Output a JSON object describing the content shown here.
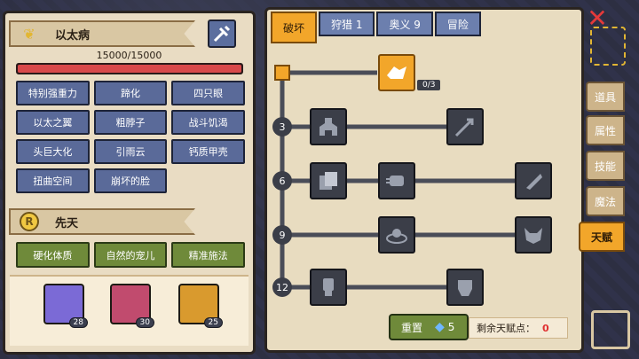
{
  "hero": {
    "name": "以太病",
    "hp_text": "15000/15000",
    "hp_fraction": 1.0
  },
  "traits": [
    "特别强重力",
    "蹄化",
    "四只眼",
    "以太之翼",
    "粗脖子",
    "战斗饥渴",
    "头巨大化",
    "引雨云",
    "钙质甲壳",
    "扭曲空间",
    "崩坏的脸"
  ],
  "natural": {
    "title": "先天",
    "emblem": "R",
    "items": [
      "硬化体质",
      "自然的宠儿",
      "精准施法"
    ]
  },
  "pets": [
    {
      "level": "28",
      "color": "#7b6ad6"
    },
    {
      "level": "30",
      "color": "#c14b6e"
    },
    {
      "level": "25",
      "color": "#d99a2e"
    }
  ],
  "tabs": [
    "破坏",
    "狩猎 1",
    "奥义 9",
    "冒险"
  ],
  "talent_tree": {
    "tiers": [
      "3",
      "6",
      "9",
      "12"
    ],
    "top_progress": "0/3"
  },
  "reset": {
    "label": "重置",
    "gem_cost": "5"
  },
  "remaining": {
    "label": "剩余天赋点：",
    "value": "0"
  },
  "side_tabs": [
    "道具",
    "属性",
    "技能",
    "魔法",
    "天赋"
  ],
  "colors": {
    "accent": "#f2a62a",
    "trait": "#5a6a99",
    "natural": "#6f8a3a",
    "hp": "#d8484a"
  }
}
